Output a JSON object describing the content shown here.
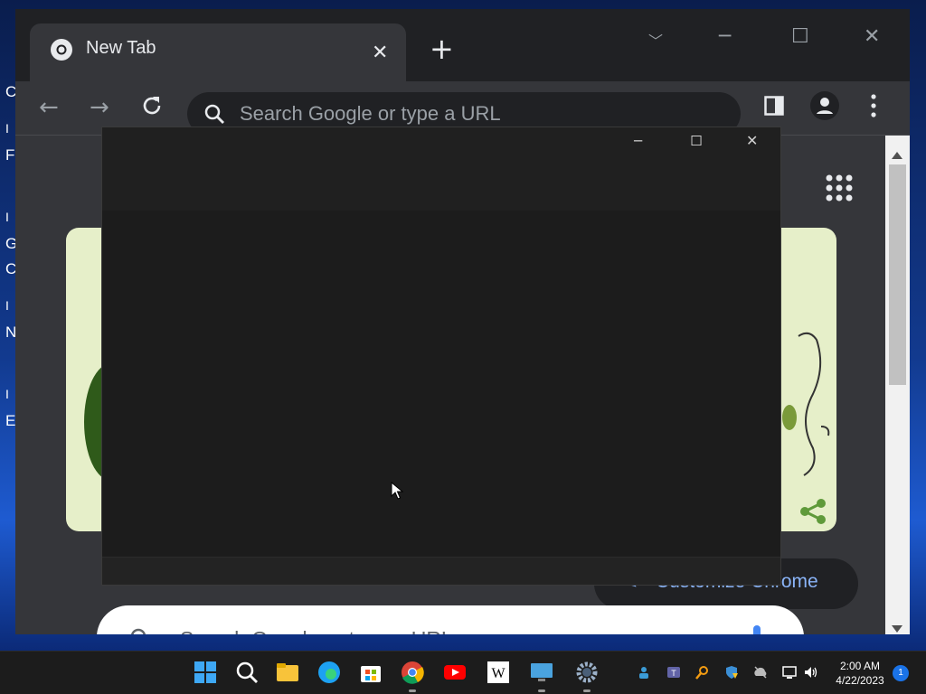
{
  "desktop": {
    "left_strip_letters": [
      "C",
      "I",
      "F",
      "I",
      "G",
      "C",
      "I",
      "N",
      "I",
      "E"
    ]
  },
  "browser": {
    "tab_title": "New Tab",
    "omnibox_placeholder": "Search Google or type a URL",
    "ntp_search_placeholder": "Search Google or type a URL",
    "customize_label": "Customize Chrome"
  },
  "taskbar": {
    "time": "2:00 AM",
    "date": "4/22/2023",
    "notification_count": "1",
    "apps": [
      "start",
      "search",
      "file-explorer",
      "edge",
      "microsoft-store",
      "chrome",
      "youtube",
      "wikipedia",
      "remote-desktop",
      "settings"
    ]
  },
  "colors": {
    "chrome_frame": "#202124",
    "chrome_toolbar": "#35363a",
    "link_blue": "#8ab4f8",
    "dialog_bg": "#1f1f1f"
  }
}
